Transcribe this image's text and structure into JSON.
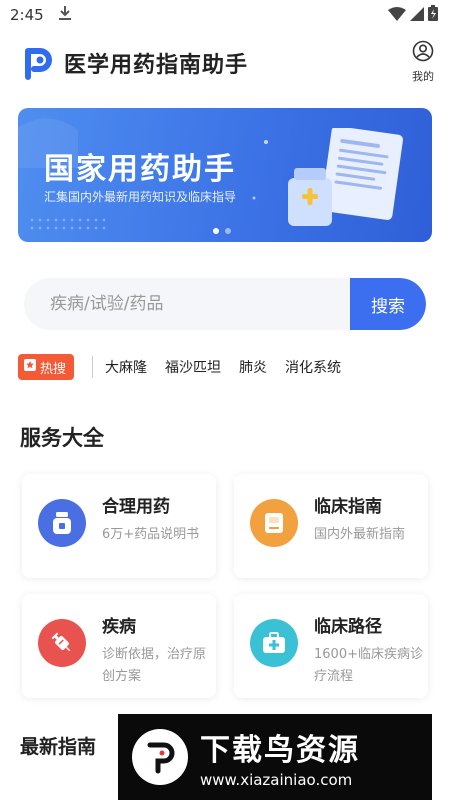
{
  "status_bar": {
    "time": "2:45"
  },
  "header": {
    "title": "医学用药指南助手",
    "mine_label": "我的"
  },
  "banner": {
    "title": "国家用药助手",
    "subtitle": "汇集国内外最新用药知识及临床指导",
    "slide_count": 2,
    "active_slide": 1
  },
  "search": {
    "placeholder": "疾病/试验/药品",
    "button_label": "搜索"
  },
  "hot_search": {
    "badge": "热搜",
    "items": [
      "大麻隆",
      "福沙匹坦",
      "肺炎",
      "消化系统"
    ]
  },
  "services": {
    "title": "服务大全",
    "cards": [
      {
        "title": "合理用药",
        "desc": "6万+药品说明书",
        "icon": "medicine-bottle-icon",
        "color": "#4a6fe3"
      },
      {
        "title": "临床指南",
        "desc": "国内外最新指南",
        "icon": "book-icon",
        "color": "#f1a23f"
      },
      {
        "title": "疾病",
        "desc": "诊断依据，治疗原创方案",
        "icon": "syringe-icon",
        "color": "#e9534f"
      },
      {
        "title": "临床路径",
        "desc": "1600+临床疾病诊疗流程",
        "icon": "medical-kit-icon",
        "color": "#3bc1d6"
      }
    ]
  },
  "latest": {
    "title": "最新指南"
  },
  "watermark": {
    "brand": "下载鸟资源",
    "url": "www.xiazainiao.com"
  }
}
